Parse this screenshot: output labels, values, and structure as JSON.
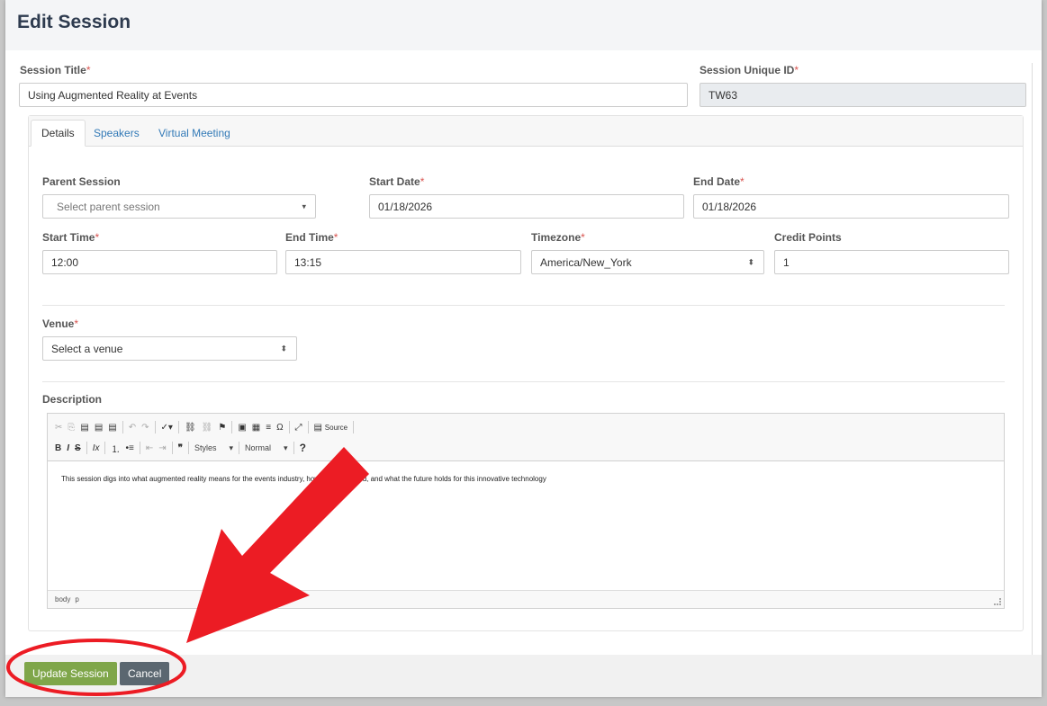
{
  "page": {
    "title": "Edit Session"
  },
  "session_title": {
    "label": "Session Title",
    "value": "Using Augmented Reality at Events"
  },
  "session_uid": {
    "label": "Session Unique ID",
    "value": "TW63"
  },
  "required_mark": "*",
  "tabs": [
    {
      "label": "Details",
      "active": true
    },
    {
      "label": "Speakers",
      "active": false
    },
    {
      "label": "Virtual Meeting",
      "active": false
    }
  ],
  "details": {
    "parent_session": {
      "label": "Parent Session",
      "placeholder": "Select parent session"
    },
    "start_date": {
      "label": "Start Date",
      "value": "01/18/2026"
    },
    "end_date": {
      "label": "End Date",
      "value": "01/18/2026"
    },
    "start_time": {
      "label": "Start Time",
      "value": "12:00"
    },
    "end_time": {
      "label": "End Time",
      "value": "13:15"
    },
    "timezone": {
      "label": "Timezone",
      "value": "America/New_York"
    },
    "credit_points": {
      "label": "Credit Points",
      "value": "1"
    },
    "venue": {
      "label": "Venue",
      "value": "Select a venue"
    },
    "description": {
      "label": "Description",
      "toolbar_source": "Source",
      "toolbar_styles": "Styles",
      "toolbar_format": "Normal",
      "body_text": "This session digs into what augmented reality means for the events industry, how it can be used, and what the future holds for this innovative technology",
      "path_body": "body",
      "path_p": "p"
    }
  },
  "footer": {
    "update_label": "Update Session",
    "cancel_label": "Cancel"
  },
  "colors": {
    "accent_green": "#7fa64a",
    "cancel_gray": "#5b6770",
    "required_red": "#d9534f",
    "annotation_red": "#ec1c24"
  }
}
